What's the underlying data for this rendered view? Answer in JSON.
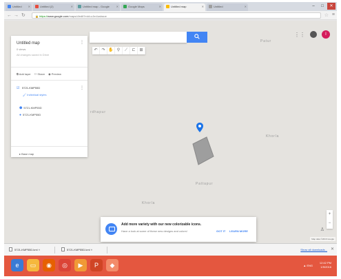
{
  "tabs": [
    {
      "label": "Untitled",
      "color": "#4285f4"
    },
    {
      "label": "Untitled (2)",
      "color": "#e74c3c"
    },
    {
      "label": "Untitled map - Google",
      "color": "#5f9ea0"
    },
    {
      "label": "Google Maps",
      "color": "#34a853"
    },
    {
      "label": "Untitled map",
      "color": "#fbbc05"
    },
    {
      "label": "Untitled",
      "color": "#9e9e9e"
    }
  ],
  "address_bar": {
    "scheme": "https://",
    "host": "www.google.com",
    "path": "/maps/d/edit?mid=zJm4ushaoe"
  },
  "map": {
    "search_button_icon": "search-icon",
    "place_labels": [
      "Patur",
      "Khorla",
      "Pattapur",
      "Khorla"
    ],
    "tools": [
      "back-icon",
      "forward-icon",
      "hand-icon",
      "marker-icon",
      "line-icon",
      "ruler-icon",
      "text-icon"
    ],
    "avatar_letter": "I",
    "zoom_in": "+",
    "zoom_out": "−",
    "pegman_icon": "pegman-icon",
    "map_data_label": "Map data ©2016 Google"
  },
  "panel": {
    "title": "Untitled map",
    "meta": "0 views",
    "subtitle": "All changes saved in Drive",
    "actions": [
      {
        "icon": "layer-icon",
        "label": "Add layer"
      },
      {
        "icon": "share-icon",
        "label": "Share"
      },
      {
        "icon": "preview-icon",
        "label": "Preview"
      }
    ],
    "layer_name": "5721-KMP55D",
    "style_link": "Individual styles",
    "features": [
      "5721-KMP55D",
      "5721-KMP55D"
    ],
    "basemap": "Base map"
  },
  "toast": {
    "title": "Add more variety with our new colorizable icons.",
    "body": "Have a look at some of these new designs and colors!",
    "got_it": "GOT IT",
    "learn_more": "LEARN MORE"
  },
  "downloads": {
    "items": [
      "5721-KMP55D.kml",
      "5721-KMP55D.kml"
    ],
    "show_all": "Show all downloads...",
    "close": "✕"
  },
  "taskbar": {
    "apps": [
      {
        "icon": "ie-icon",
        "color": "#3a7bd5"
      },
      {
        "icon": "explorer-icon",
        "color": "#f5b83d"
      },
      {
        "icon": "firefox-icon",
        "color": "#e66000"
      },
      {
        "icon": "chrome-icon",
        "color": "#db4437"
      },
      {
        "icon": "media-icon",
        "color": "#f09a36"
      },
      {
        "icon": "powerpoint-icon",
        "color": "#d04525"
      },
      {
        "icon": "other-app-icon",
        "color": "#f28c6a"
      }
    ],
    "time": "12:42 PM",
    "date": "1/9/2016",
    "lang": "ENG"
  }
}
